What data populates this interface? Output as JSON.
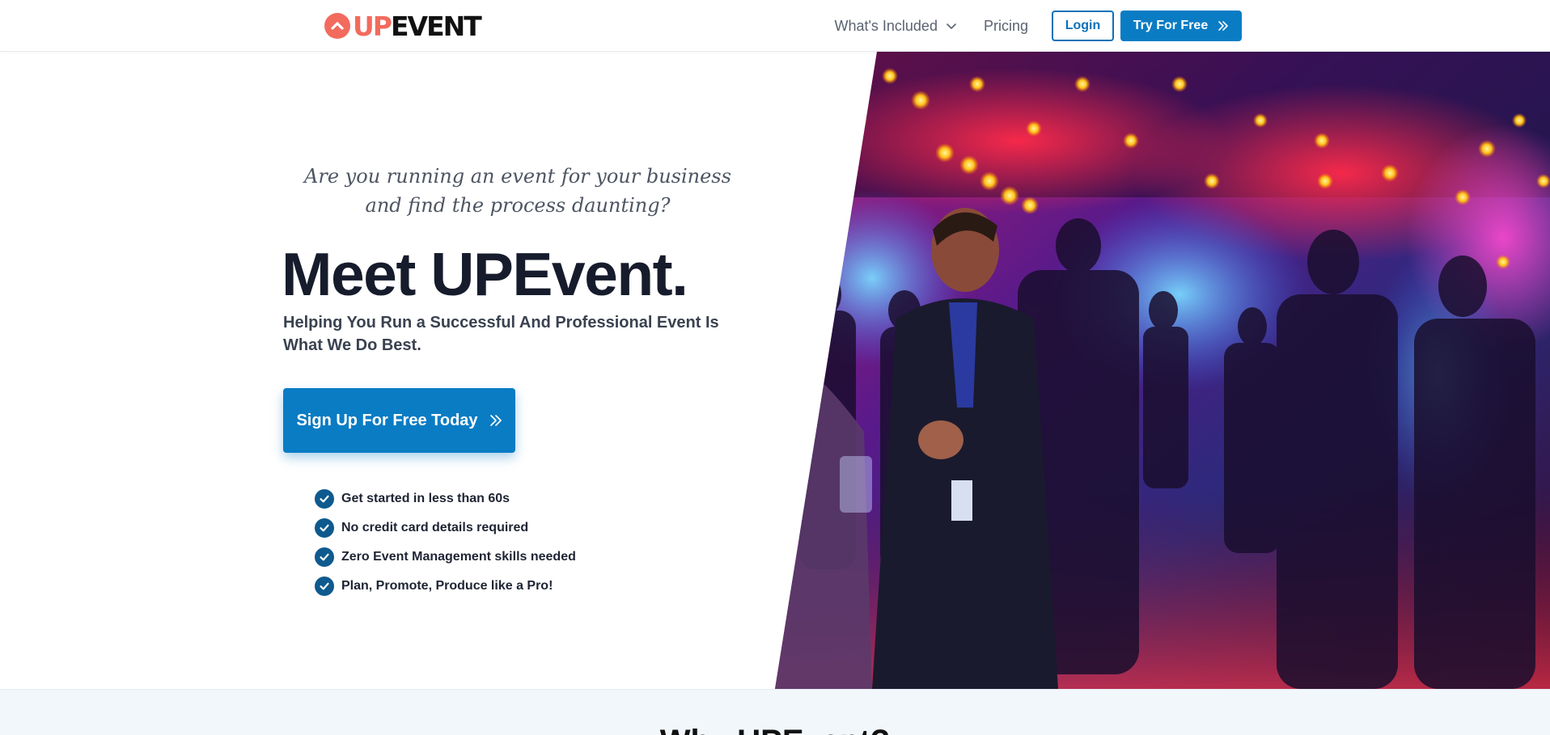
{
  "header": {
    "logo_up": "UP",
    "logo_event": "EVENT",
    "nav_whats_included": "What's Included",
    "nav_pricing": "Pricing",
    "login_label": "Login",
    "try_label": "Try For Free"
  },
  "hero": {
    "tagline": "Are you running an event for your business and find the process daunting?",
    "headline": "Meet UPEvent.",
    "subhead": "Helping You Run a Successful And Professional Event Is What We Do Best.",
    "cta_label": "Sign Up For Free Today",
    "features": [
      "Get started in less than 60s",
      "No credit card details required",
      "Zero Event Management skills needed",
      "Plan, Promote, Produce like a Pro!"
    ],
    "image_alt": "event-networking-photo"
  },
  "next_section": {
    "title": "Why UPEvent?"
  },
  "colors": {
    "brand_coral": "#f26b5e",
    "primary_blue": "#0a7cc4",
    "check_blue": "#0e5a8e"
  }
}
